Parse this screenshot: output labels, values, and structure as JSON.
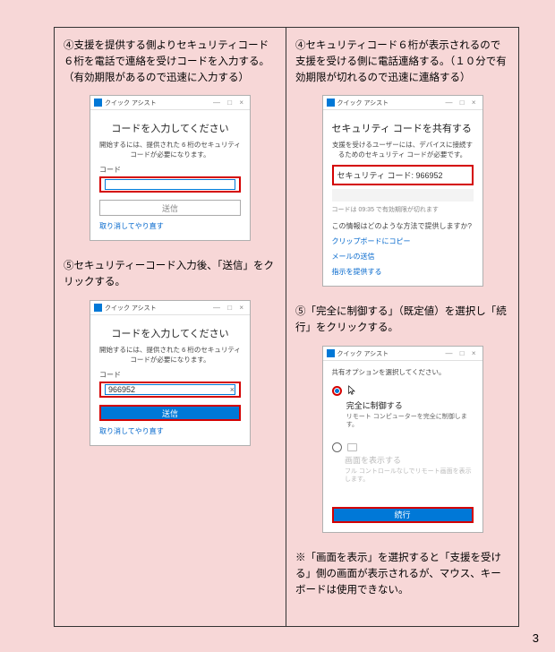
{
  "page_number": "3",
  "left": {
    "step4_text": "④支援を提供する側よりセキュリティコード６桁を電話で連絡を受けコードを入力する。（有効期限があるので迅速に入力する）",
    "step5_text": "⑤セキュリティーコード入力後、「送信」をクリックする。",
    "win1": {
      "title": "クイック アシスト",
      "heading": "コードを入力してください",
      "desc": "開始するには、提供された 6 桁のセキュリティ コードが必要になります。",
      "label": "コード",
      "value": "",
      "send_btn": "送信",
      "cancel_link": "取り消してやり直す"
    },
    "win2": {
      "title": "クイック アシスト",
      "heading": "コードを入力してください",
      "desc": "開始するには、提供された 6 桁のセキュリティ コードが必要になります。",
      "label": "コード",
      "value": "966952",
      "send_btn": "送信",
      "cancel_link": "取り消してやり直す"
    }
  },
  "right": {
    "step4_text": "④セキュリティコード６桁が表示されるので支援を受ける側に電話連絡する。（１０分で有効期限が切れるので迅速に連絡する）",
    "step5_text": "⑤「完全に制御する」（既定値）を選択し「続行」をクリックする。",
    "note_text": "※「画面を表示」を選択すると「支援を受ける」側の画面が表示されるが、マウス、キーボードは使用できない。",
    "win1": {
      "title": "クイック アシスト",
      "heading": "セキュリティ コードを共有する",
      "desc": "支援を受けるユーザーには、デバイスに接続するためのセキュリティ コードが必要です。",
      "code_label": "セキュリティ コード: 966952",
      "expire": "コードは 09:35 で有効期限が切れます",
      "share_q": "この情報はどのような方法で提供しますか?",
      "link1": "クリップボードにコピー",
      "link2": "メールの送信",
      "link3": "指示を提供する"
    },
    "win2": {
      "title": "クイック アシスト",
      "heading": "共有オプションを選択してください。",
      "opt1_title": "完全に制御する",
      "opt1_desc": "リモート コンピューターを完全に制御します。",
      "opt2_title": "画面を表示する",
      "opt2_desc": "フル コントロールなしでリモート画面を表示します。",
      "continue_btn": "続行"
    }
  }
}
